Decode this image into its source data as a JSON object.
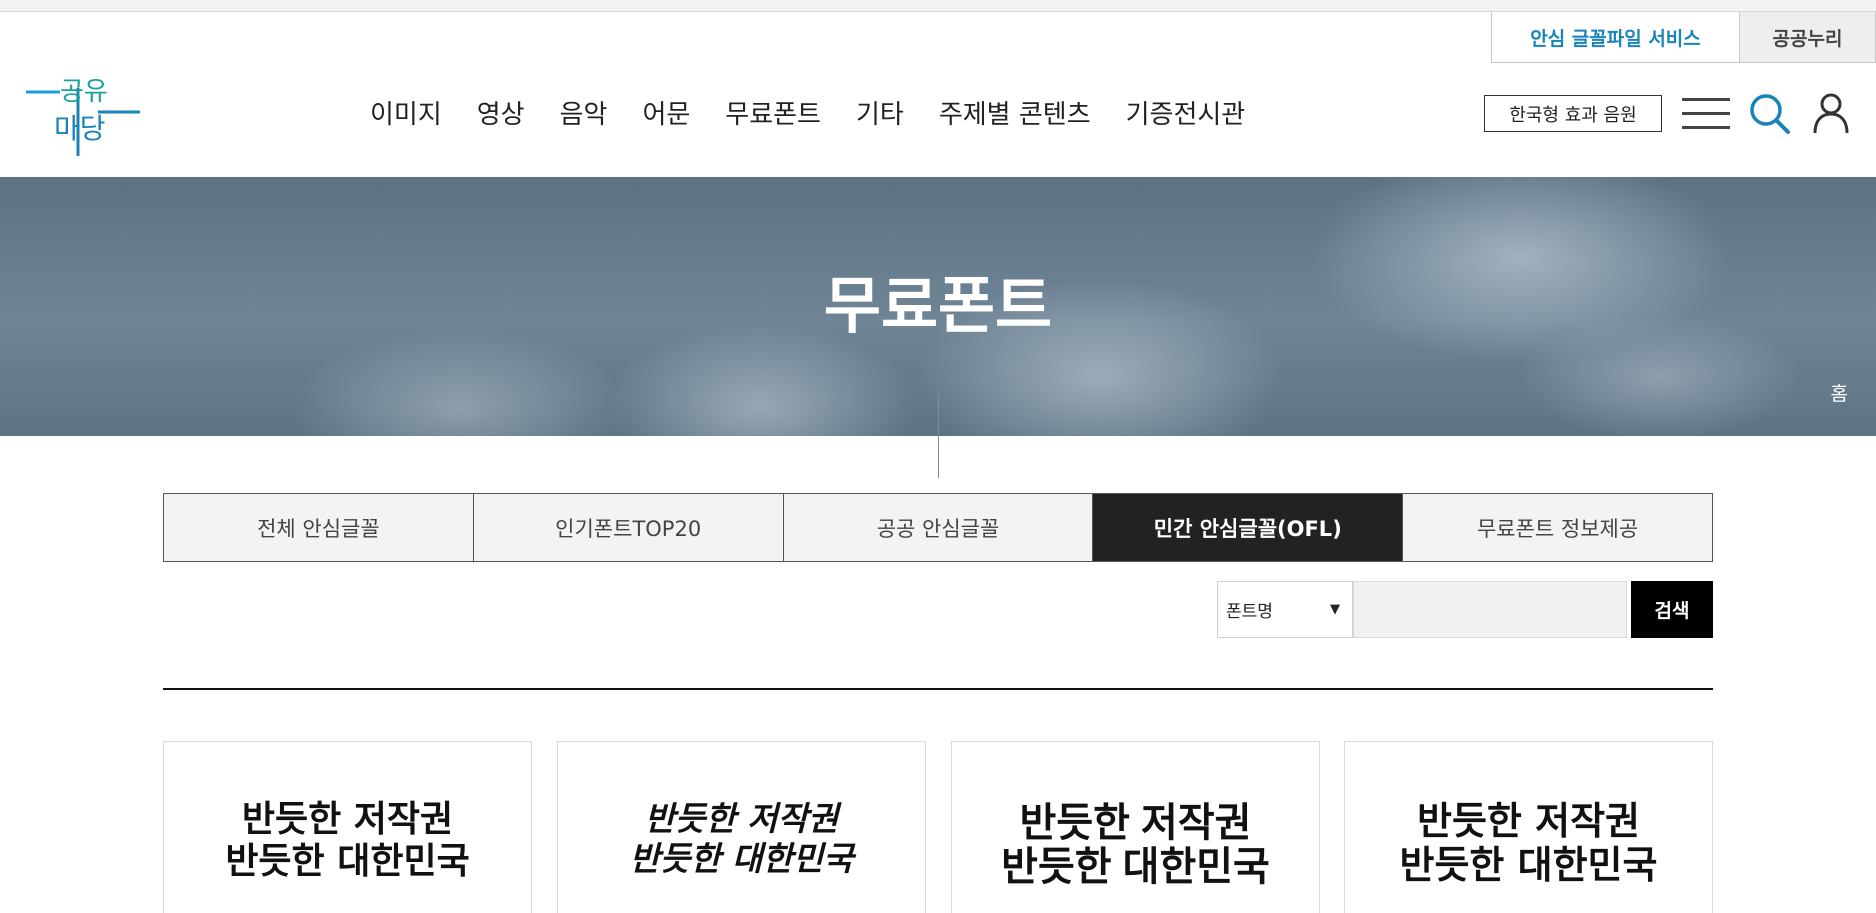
{
  "util_links": [
    "안심 글꼴파일 서비스",
    "공공누리"
  ],
  "logo": {
    "line1": "공유",
    "line2": "마당"
  },
  "nav": [
    "이미지",
    "영상",
    "음악",
    "어문",
    "무료폰트",
    "기타",
    "주제별 콘텐츠",
    "기증전시관"
  ],
  "header_button": "한국형 효과 음원",
  "icons": [
    "hamburger-menu-icon",
    "search-icon",
    "user-icon"
  ],
  "hero": {
    "title": "무료폰트",
    "breadcrumb_home": "홈"
  },
  "tabs": [
    {
      "label": "전체 안심글꼴",
      "active": false
    },
    {
      "label": "인기폰트TOP20",
      "active": false
    },
    {
      "label": "공공 안심글꼴",
      "active": false
    },
    {
      "label": "민간 안심글꼴(OFL)",
      "active": true
    },
    {
      "label": "무료폰트 정보제공",
      "active": false
    }
  ],
  "search": {
    "select_value": "폰트명",
    "input_value": "",
    "button_label": "검색"
  },
  "cards": [
    {
      "line1": "반듯한 저작권",
      "line2": "반듯한 대한민국"
    },
    {
      "line1": "반듯한 저작권",
      "line2": "반듯한 대한민국"
    },
    {
      "line1": "반듯한 저작권",
      "line2": "반듯한 대한민국"
    },
    {
      "line1": "반듯한 저작권",
      "line2": "반듯한 대한민국"
    }
  ],
  "colors": {
    "accent": "#1a84b8",
    "logo_green": "#1aa39a",
    "active_tab": "#222222",
    "hero": "#6a8090"
  }
}
